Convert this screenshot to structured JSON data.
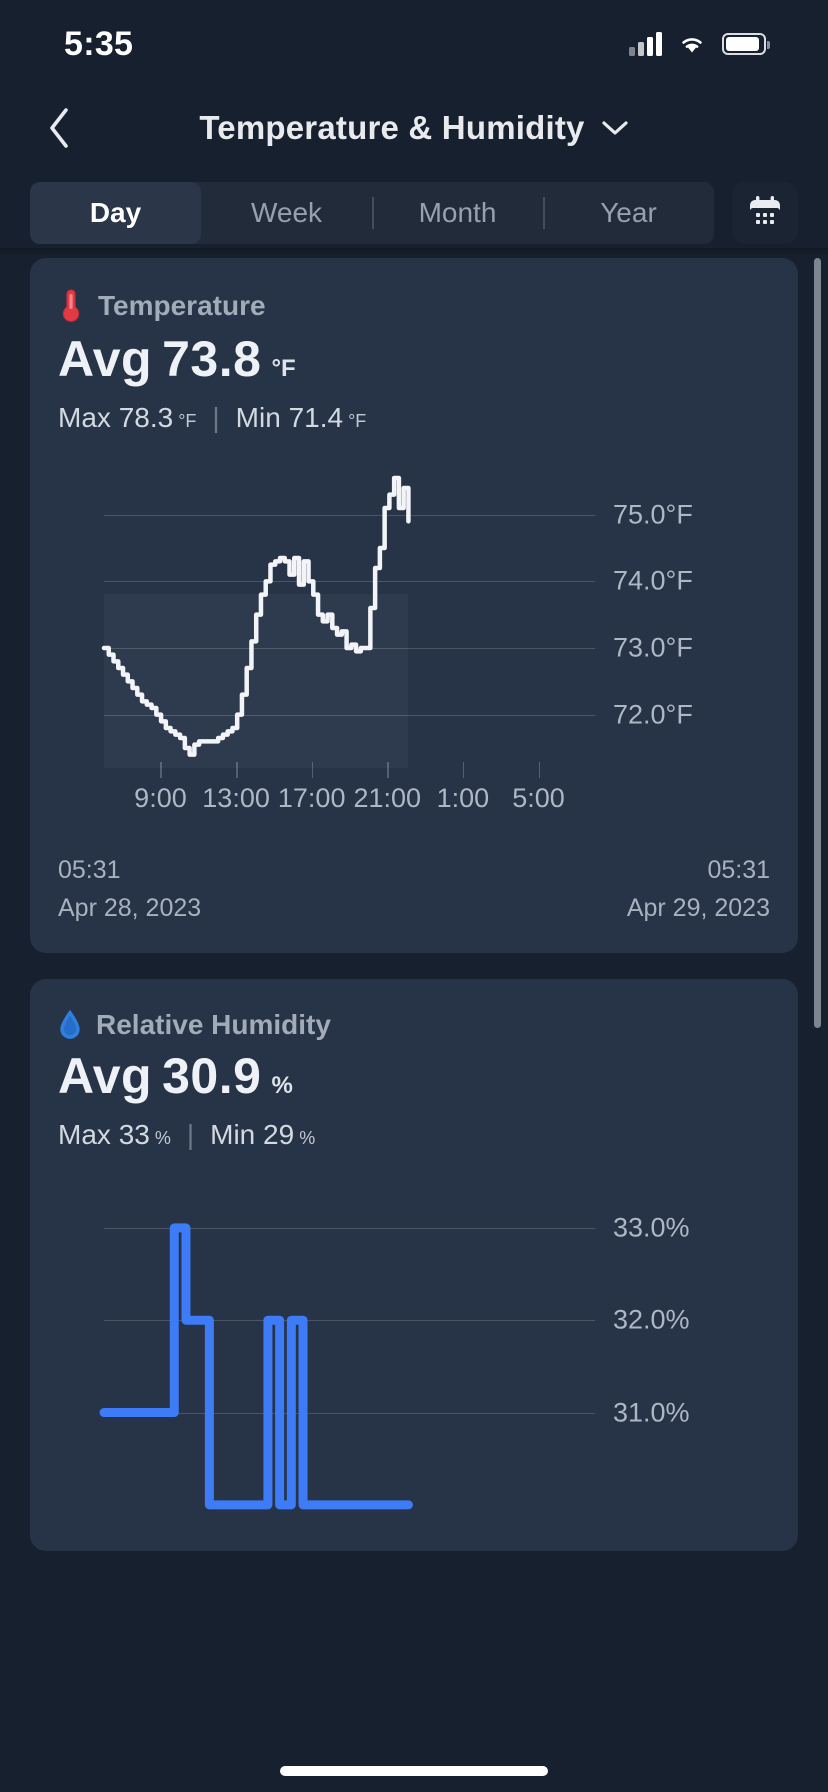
{
  "status_bar": {
    "time": "5:35",
    "signal_icon": "cellular-signal-icon",
    "wifi_icon": "wifi-icon",
    "battery_icon": "battery-icon"
  },
  "nav": {
    "back_icon": "chevron-left-icon",
    "title": "Temperature & Humidity",
    "dropdown_icon": "chevron-down-icon"
  },
  "range_tabs": {
    "items": [
      {
        "label": "Day",
        "selected": true
      },
      {
        "label": "Week",
        "selected": false
      },
      {
        "label": "Month",
        "selected": false
      },
      {
        "label": "Year",
        "selected": false
      }
    ],
    "calendar_button_icon": "calendar-icon"
  },
  "cards": [
    {
      "icon": "thermometer-icon",
      "icon_color": "#d32f3a",
      "label": "Temperature",
      "avg_prefix": "Avg",
      "avg_value": "73.8",
      "avg_unit": "°F",
      "max_prefix": "Max",
      "max_value": "78.3",
      "max_unit": "°F",
      "divider": "|",
      "min_prefix": "Min",
      "min_value": "71.4",
      "min_unit": "°F",
      "start_time": "05:31",
      "start_date": "Apr 28, 2023",
      "end_time": "05:31",
      "end_date": "Apr 29, 2023"
    },
    {
      "icon": "water-drop-icon",
      "icon_color": "#2f7fe0",
      "label": "Relative Humidity",
      "avg_prefix": "Avg",
      "avg_value": "30.9",
      "avg_unit": "%",
      "max_prefix": "Max",
      "max_value": "33",
      "max_unit": "%",
      "divider": "|",
      "min_prefix": "Min",
      "min_value": "29",
      "min_unit": "%"
    }
  ],
  "chart_data": [
    {
      "type": "line",
      "title": "Temperature",
      "ylabel": "°F",
      "xlabel": "",
      "ylim": [
        71.2,
        75.7
      ],
      "yticks": [
        75.0,
        74.0,
        73.0,
        72.0
      ],
      "ytick_labels": [
        "75.0°F",
        "74.0°F",
        "73.0°F",
        "72.0°F"
      ],
      "xticks": [
        "9:00",
        "13:00",
        "17:00",
        "21:00",
        "1:00",
        "5:00"
      ],
      "grid": true,
      "legend": "none",
      "line_color": "#f2f4f7",
      "x": [
        0,
        1,
        2,
        3,
        4,
        5,
        6,
        7,
        8,
        9,
        10,
        11,
        12,
        13,
        14,
        15,
        16,
        17,
        18,
        19,
        20,
        21,
        22,
        23,
        24,
        25,
        26,
        27,
        28,
        29,
        30,
        31,
        32,
        33,
        34,
        35,
        36,
        37,
        38,
        39,
        40,
        41,
        42,
        43,
        44,
        45,
        46,
        47,
        48,
        49,
        50,
        51,
        52,
        53,
        54,
        55,
        56,
        57,
        58,
        59,
        60,
        61,
        62,
        63,
        64
      ],
      "values": [
        73.0,
        72.9,
        72.8,
        72.7,
        72.6,
        72.5,
        72.4,
        72.3,
        72.2,
        72.15,
        72.1,
        72.0,
        71.9,
        71.8,
        71.75,
        71.7,
        71.65,
        71.5,
        71.4,
        71.55,
        71.6,
        71.6,
        71.6,
        71.6,
        71.65,
        71.7,
        71.75,
        71.8,
        72.0,
        72.3,
        72.7,
        73.1,
        73.5,
        73.8,
        74.0,
        74.25,
        74.3,
        74.35,
        74.3,
        74.1,
        74.35,
        73.95,
        74.3,
        74.0,
        73.8,
        73.5,
        73.4,
        73.5,
        73.3,
        73.2,
        73.25,
        73.0,
        73.05,
        72.95,
        73.0,
        73.0,
        73.6,
        74.2,
        74.5,
        75.1,
        75.3,
        75.55,
        75.1,
        75.4,
        74.9
      ],
      "start_label": "05:31  Apr 28, 2023",
      "end_label": "05:31  Apr 29, 2023"
    },
    {
      "type": "line",
      "title": "Relative Humidity",
      "ylabel": "%",
      "xlabel": "",
      "ylim": [
        29.5,
        33.4
      ],
      "yticks": [
        33.0,
        32.0,
        31.0
      ],
      "ytick_labels": [
        "33.0%",
        "32.0%",
        "31.0%"
      ],
      "xticks": [],
      "grid": true,
      "legend": "none",
      "line_color": "#3d7bf7",
      "x": [
        0,
        1,
        2,
        3,
        4,
        5,
        6,
        7,
        8,
        9,
        10,
        11,
        12,
        13,
        14,
        15,
        16,
        17,
        18,
        19,
        20,
        21,
        22,
        23,
        24,
        25,
        26
      ],
      "values": [
        31.0,
        31.0,
        31.0,
        31.0,
        31.0,
        31.0,
        33.0,
        32.0,
        32.0,
        30.0,
        30.0,
        30.0,
        30.0,
        30.0,
        32.0,
        30.0,
        32.0,
        30.0,
        30.0,
        30.0,
        30.0,
        30.0,
        30.0,
        30.0,
        30.0,
        30.0,
        30.0
      ]
    }
  ]
}
